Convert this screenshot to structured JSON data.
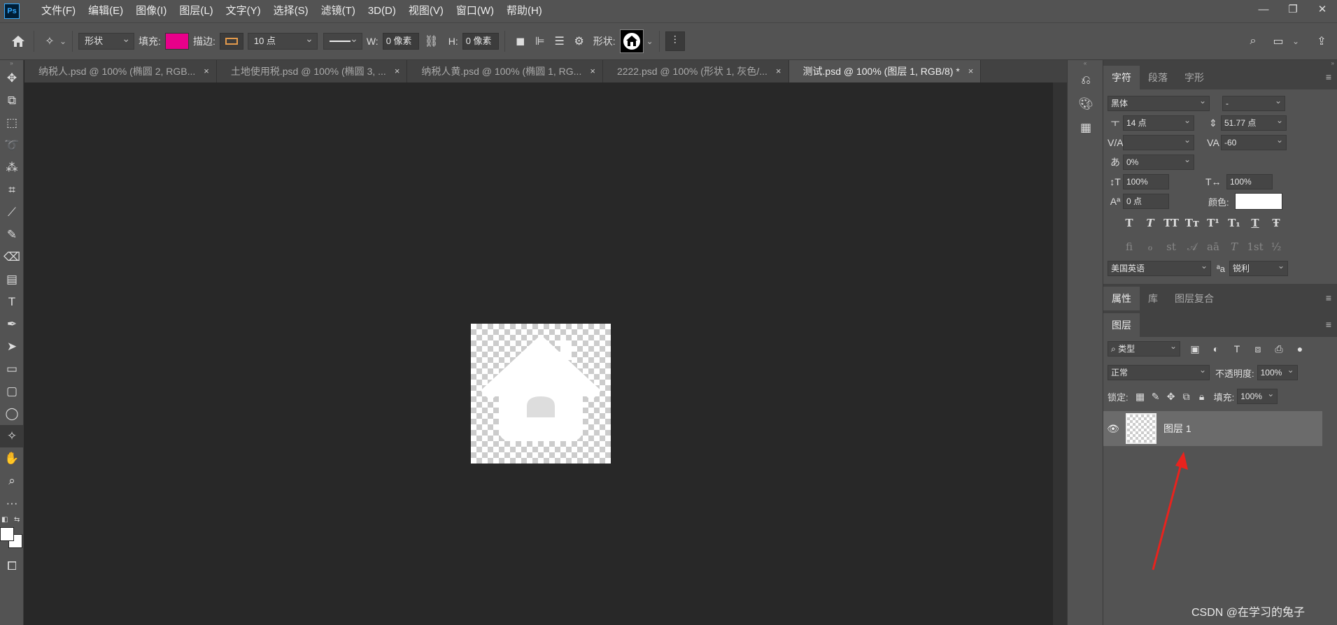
{
  "app": {
    "logo": "Ps"
  },
  "menu": [
    "文件(F)",
    "编辑(E)",
    "图像(I)",
    "图层(L)",
    "文字(Y)",
    "选择(S)",
    "滤镜(T)",
    "3D(D)",
    "视图(V)",
    "窗口(W)",
    "帮助(H)"
  ],
  "window_controls": {
    "minimize": "—",
    "restore": "❐",
    "close": "✕"
  },
  "options": {
    "mode": "形状",
    "fill_label": "填充:",
    "fill_color": "#e8008a",
    "stroke_label": "描边:",
    "stroke_width": "10 点",
    "w_label": "W:",
    "w_value": "0 像素",
    "h_label": "H:",
    "h_value": "0 像素",
    "shape_label": "形状:"
  },
  "tabs": [
    {
      "label": "纳税人.psd @ 100% (椭圆 2, RGB...",
      "close": "×"
    },
    {
      "label": "土地使用税.psd @ 100% (椭圆 3, ...",
      "close": "×"
    },
    {
      "label": "纳税人黄.psd @ 100% (椭圆 1, RG...",
      "close": "×"
    },
    {
      "label": "2222.psd @ 100% (形状 1, 灰色/...",
      "close": "×"
    },
    {
      "label": "测试.psd @ 100% (图层 1, RGB/8) *",
      "close": "×"
    }
  ],
  "character_panel": {
    "tabs": [
      "字符",
      "段落",
      "字形"
    ],
    "font_family": "黑体",
    "font_style": "-",
    "font_size": "14 点",
    "leading": "51.77 点",
    "kerning": "",
    "tracking": "-60",
    "tsume": "0%",
    "vertical_scale": "100%",
    "horizontal_scale": "100%",
    "baseline_shift": "0 点",
    "color_label": "颜色:",
    "color": "#ffffff",
    "typo_buttons": [
      "T",
      "T",
      "TT",
      "Tт",
      "T¹",
      "T₁",
      "T",
      "Ŧ"
    ],
    "opentype_buttons": [
      "fi",
      "ℴ",
      "st",
      "𝒜",
      "aā",
      "T",
      "1st",
      "½"
    ],
    "language": "美国英语",
    "aa_label": "ªa",
    "antialias": "锐利"
  },
  "properties_tabs": [
    "属性",
    "库",
    "图层复合"
  ],
  "layers_panel": {
    "title": "图层",
    "filter": "类型",
    "blend_mode": "正常",
    "opacity_label": "不透明度:",
    "opacity": "100%",
    "lock_label": "锁定:",
    "fill_label": "填充:",
    "fill": "100%",
    "layers": [
      {
        "name": "图层 1",
        "visible": true
      }
    ]
  },
  "watermark": "CSDN @在学习的兔子"
}
